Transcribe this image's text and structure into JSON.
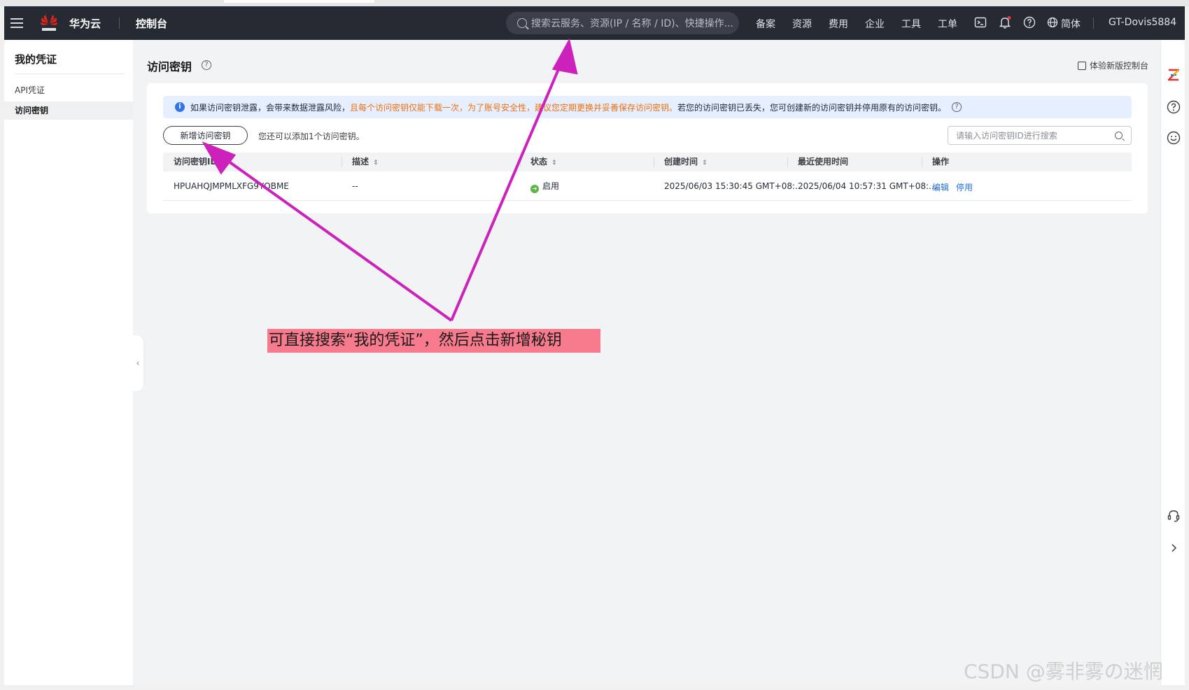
{
  "header": {
    "brand": "华为云",
    "console": "控制台",
    "search_placeholder": "搜索云服务、资源(IP / 名称 / ID)、快捷操作...",
    "nav": [
      "备案",
      "资源",
      "费用",
      "企业",
      "工具",
      "工单"
    ],
    "language": "简体",
    "user": "GT-Dovis5884"
  },
  "sidebar": {
    "title": "我的凭证",
    "items": [
      {
        "label": "API凭证",
        "active": false
      },
      {
        "label": "访问密钥",
        "active": true
      }
    ]
  },
  "main": {
    "title": "访问密钥",
    "new_console": "体验新版控制台",
    "alert": {
      "part1": "如果访问密钥泄露，会带来数据泄露风险，",
      "part2": "且每个访问密钥仅能下载一次，为了账号安全性，建议您定期更换并妥善保存访问密钥。",
      "part3": "若您的访问密钥已丢失，您可创建新的访问密钥并停用原有的访问密钥。"
    },
    "add_button": "新增访问密钥",
    "hint": "您还可以添加1个访问密钥。",
    "search_placeholder": "请输入访问密钥ID进行搜索",
    "table": {
      "columns": [
        "访问密钥ID",
        "描述",
        "状态",
        "创建时间",
        "最近使用时间",
        "操作"
      ],
      "rows": [
        {
          "id": "HPUAHQJMPMLXFG9YQBME",
          "description": "--",
          "status": "启用",
          "created": "2025/06/03 15:30:45 GMT+08:...",
          "last_used": "2025/06/04 10:57:31 GMT+08:...",
          "actions": [
            "编辑",
            "停用"
          ]
        }
      ]
    }
  },
  "annotation": {
    "text": "可直接搜索“我的凭证”，然后点击新增秘钥",
    "color": "#f77a8d",
    "arrow_color": "#cc22bb"
  },
  "watermark": "CSDN @雾非雾の迷惘",
  "colors": {
    "header_bg": "#252a33",
    "accent_link": "#1e6fd9",
    "alert_bg": "#e5efff",
    "warning_text": "#f2700a",
    "status_green": "#5ab845"
  }
}
